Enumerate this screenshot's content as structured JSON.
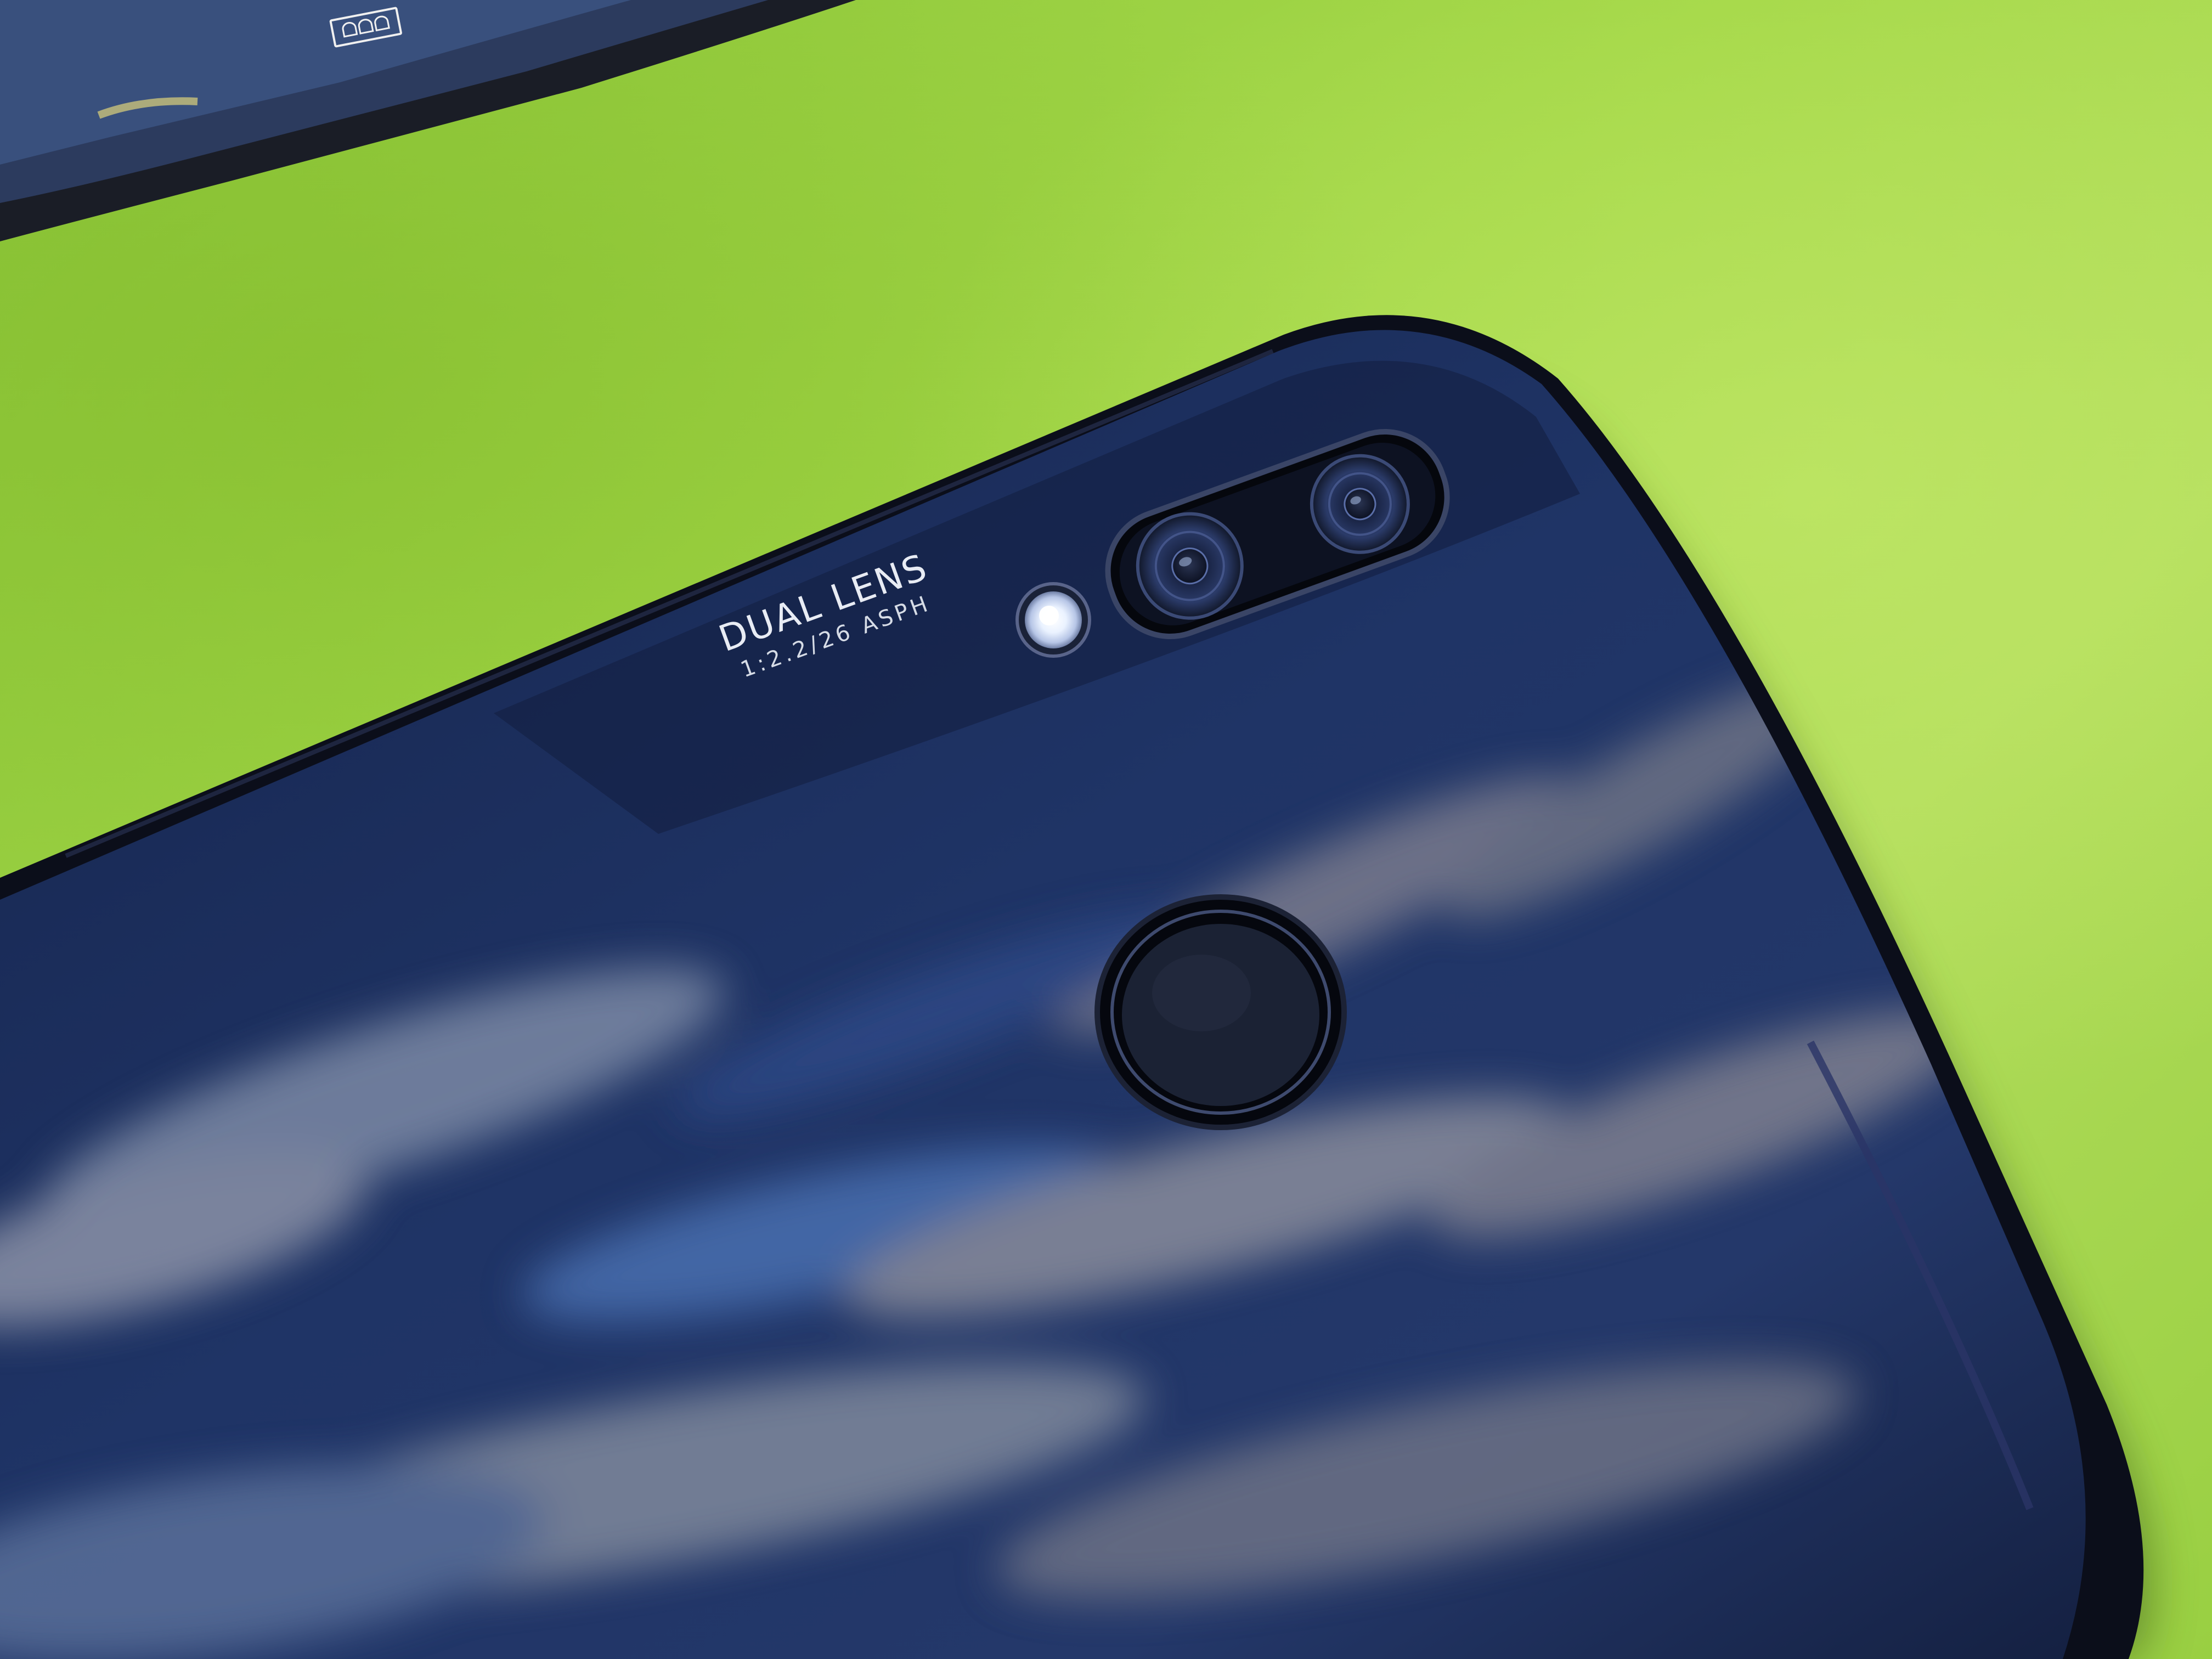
{
  "scene": {
    "engraving": {
      "line1": "DUAL LENS",
      "line2": "1:2.2/26 ASPH"
    },
    "box_label": "ᗝᗝᗝ"
  },
  "colors": {
    "surface": "#9bd23f",
    "phone_body": "#0b0e1a",
    "glass_back": "#1b2a55",
    "flash": "#e9f1ff"
  }
}
